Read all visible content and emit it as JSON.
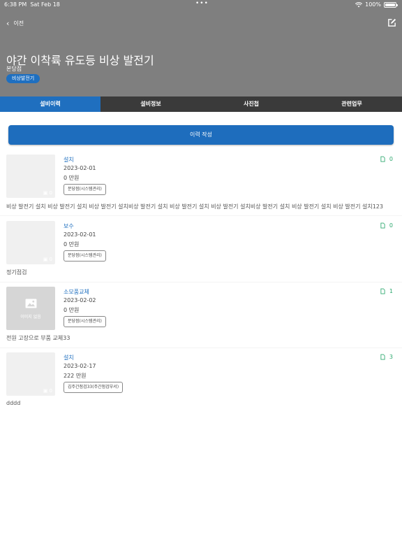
{
  "status_bar": {
    "time": "6:38 PM",
    "date": "Sat Feb 18",
    "battery": "100%"
  },
  "nav": {
    "back_label": "이전"
  },
  "header": {
    "title": "야간 이착륙 유도등 비상 발전기",
    "subtitle": "본당점",
    "badge": "비상발전기"
  },
  "tabs": [
    {
      "label": "설비이력",
      "active": true
    },
    {
      "label": "설비정보",
      "active": false
    },
    {
      "label": "사진첩",
      "active": false
    },
    {
      "label": "관련업무",
      "active": false
    }
  ],
  "cta": {
    "label": "이력 작성"
  },
  "items": [
    {
      "type": "설치",
      "date": "2023-02-01",
      "cost": "0 만원",
      "tag": "분당점(시스템관리)",
      "count": "0",
      "desc": "비상 발전기 설치 비상 발전기 설치 비상 발전기 설치비상 발전기 설치 비상 발전기 설치 비상 발전기 설치비상 발전기 설치 비상 발전기 설치 비상 발전기 설치123",
      "thumb_label": ""
    },
    {
      "type": "보수",
      "date": "2023-02-01",
      "cost": "0 만원",
      "tag": "분당점(시스템관리)",
      "count": "0",
      "desc": "정기점검",
      "thumb_label": ""
    },
    {
      "type": "소모품교체",
      "date": "2023-02-02",
      "cost": "0 만원",
      "tag": "분당점(시스템관리)",
      "count": "1",
      "desc": "전원 고장으로 부품 교체33",
      "thumb_label": "이미지 없음"
    },
    {
      "type": "설치",
      "date": "2023-02-17",
      "cost": "222 만원",
      "tag": "김주간점검33(주간점검부서)",
      "count": "3",
      "desc": "dddd",
      "thumb_label": ""
    }
  ],
  "colors": {
    "header_bg": "#7f7f7f",
    "accent": "#1f6fbf",
    "count_green": "#2da86e",
    "tabs_bg": "#3a3a3a"
  }
}
